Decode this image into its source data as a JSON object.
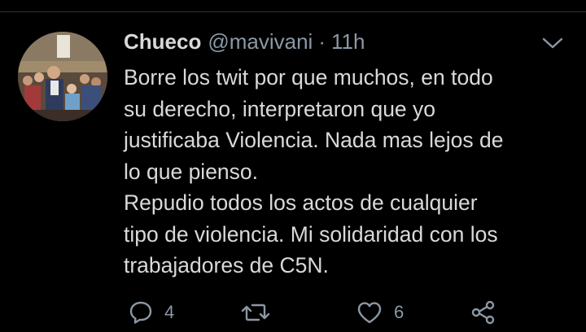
{
  "tweet": {
    "author_name": "Chueco",
    "handle": "@mavivani",
    "separator": "·",
    "time": "11h",
    "text_lines": [
      "Borre los twit por que muchos, en todo",
      "su derecho, interpretaron que yo",
      "justificaba Violencia. Nada mas lejos de",
      "lo que pienso.",
      "Repudio todos los actos de cualquier",
      "tipo de violencia. Mi solidaridad con los",
      "trabajadores de C5N."
    ],
    "reply_count": "4",
    "like_count": "6"
  },
  "icons": {
    "menu": "chevron-down-icon",
    "reply": "reply-icon",
    "retweet": "retweet-icon",
    "like": "heart-icon",
    "share": "share-icon"
  },
  "colors": {
    "background": "#000000",
    "primary_text": "#d9d9d9",
    "secondary_text": "#8b98a5",
    "divider": "#2f3336"
  }
}
